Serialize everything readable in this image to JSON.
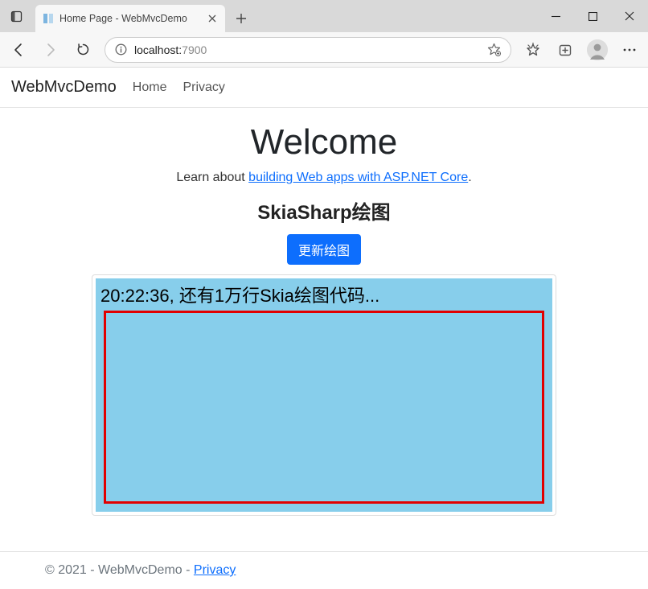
{
  "window": {
    "tab_title": "Home Page - WebMvcDemo"
  },
  "address": {
    "host": "localhost:",
    "port": "7900"
  },
  "navbar": {
    "brand": "WebMvcDemo",
    "links": [
      "Home",
      "Privacy"
    ]
  },
  "main": {
    "welcome": "Welcome",
    "learn_prefix": "Learn about ",
    "learn_link": "building Web apps with ASP.NET Core",
    "learn_suffix": ".",
    "skia_heading": "SkiaSharp绘图",
    "refresh_button": "更新绘图",
    "canvas_text": "20:22:36, 还有1万行Skia绘图代码..."
  },
  "footer": {
    "text": "© 2021 - WebMvcDemo - ",
    "privacy": "Privacy"
  }
}
